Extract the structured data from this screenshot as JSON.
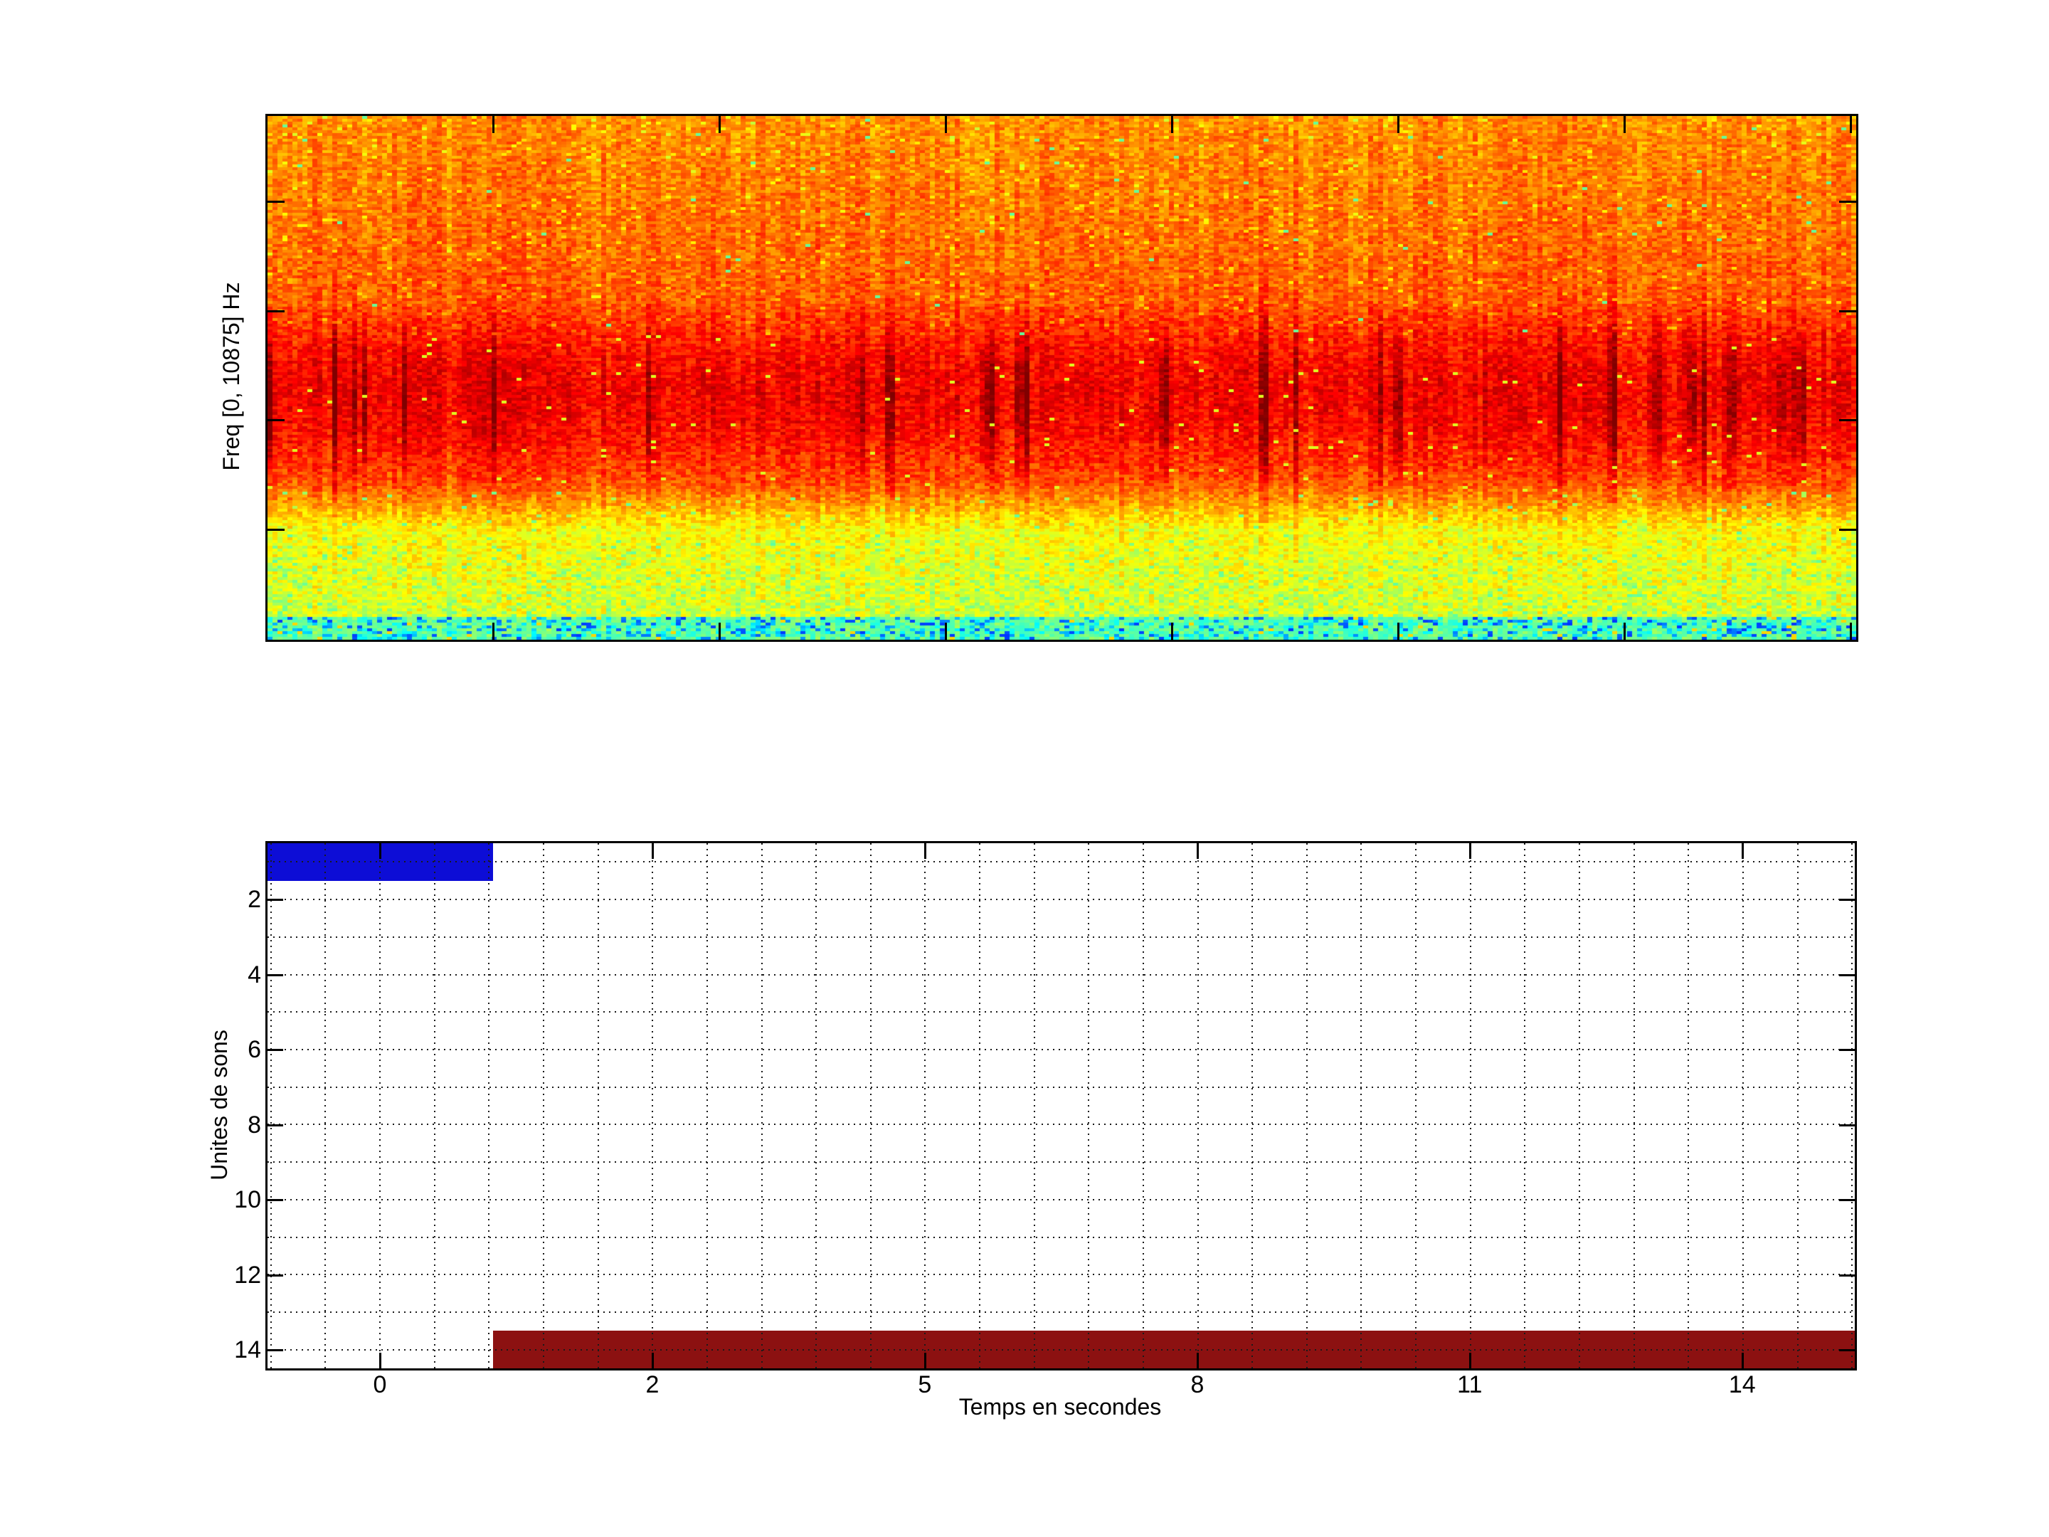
{
  "figure": {
    "background": "#ffffff",
    "border_color": "#000000",
    "grid_color": "#1a1a1a"
  },
  "spectrogram": {
    "ylabel": "Freq [0, 10875] Hz",
    "colormap": "jet",
    "noise_seed": 7,
    "x_tick_fracs": [
      0.142,
      0.2844,
      0.4267,
      0.5692,
      0.7116,
      0.854,
      0.9965
    ],
    "y_tick_fracs": [
      0.163,
      0.3723,
      0.5802,
      0.7894
    ],
    "bands": [
      {
        "name": "high-freq orange noise field",
        "from_frac": 0.0,
        "to_frac": 0.36,
        "dominant_colors": [
          "#ff8400",
          "#ffc800",
          "#ff3c00"
        ]
      },
      {
        "name": "mid-band intense red striations",
        "from_frac": 0.36,
        "to_frac": 0.7,
        "dominant_colors": [
          "#ff2a00",
          "#c81e00",
          "#ff7800"
        ]
      },
      {
        "name": "red-to-orange fade",
        "from_frac": 0.7,
        "to_frac": 0.792,
        "dominant_colors": [
          "#ff6a00",
          "#ffb000"
        ]
      },
      {
        "name": "low-freq yellow band with green specks",
        "from_frac": 0.792,
        "to_frac": 0.959,
        "dominant_colors": [
          "#f4f000",
          "#8ce85a"
        ]
      },
      {
        "name": "lowest-freq cyan band with blue dashes",
        "from_frac": 0.959,
        "to_frac": 1.0,
        "dominant_colors": [
          "#46e6c8",
          "#2050ff"
        ]
      }
    ]
  },
  "bar_chart": {
    "xlabel": "Temps en secondes",
    "ylabel": "Unites de sons",
    "x_ticks": [
      {
        "label": "0",
        "frac": 0.0708
      },
      {
        "label": "2",
        "frac": 0.2425
      },
      {
        "label": "5",
        "frac": 0.4141
      },
      {
        "label": "8",
        "frac": 0.5858
      },
      {
        "label": "11",
        "frac": 0.7574
      },
      {
        "label": "14",
        "frac": 0.9291
      }
    ],
    "x_minor": {
      "start_frac": 0.00215,
      "step_frac": 0.03435,
      "count": 30
    },
    "y_ticks": [
      {
        "label": "2",
        "frac": 0.1077
      },
      {
        "label": "4",
        "frac": 0.2506
      },
      {
        "label": "6",
        "frac": 0.3934
      },
      {
        "label": "8",
        "frac": 0.5363
      },
      {
        "label": "10",
        "frac": 0.6791
      },
      {
        "label": "12",
        "frac": 0.8219
      },
      {
        "label": "14",
        "frac": 0.9648
      }
    ],
    "y_minor": {
      "unit_frac": 0.07143,
      "first_unit": 1,
      "count": 14
    },
    "bars": [
      {
        "name": "bar-unit-1",
        "unit": 1,
        "color": "#0d0dd6",
        "x_frac": [
          0.0,
          0.1421
        ],
        "y_frac": [
          0.0,
          0.0712
        ]
      },
      {
        "name": "bar-unit-14",
        "unit": 14,
        "color": "#8c1111",
        "x_frac": [
          0.1421,
          1.0
        ],
        "y_frac": [
          0.9282,
          1.0
        ]
      }
    ]
  },
  "chart_data": [
    {
      "type": "heatmap",
      "subplot": "top",
      "title": "",
      "xlabel": "",
      "ylabel": "Freq [0, 10875] Hz",
      "colormap": "jet",
      "x_axis": {
        "ticks_labeled": false,
        "n_ticks": 7,
        "tick_fracs": [
          0.142,
          0.2844,
          0.4267,
          0.5692,
          0.7116,
          0.854,
          0.9965
        ]
      },
      "y_axis": {
        "range_hz": [
          0,
          10875
        ],
        "ticks_labeled": false,
        "n_ticks": 4
      },
      "content": "Audio spectrogram of continuous noise: orange high-energy field across upper frequencies with yellow flecks, darker red vertical striations in the mid band, a yellow band with green/cyan specks at low frequencies, and a thin cyan band with blue dashes at the lowest frequencies"
    },
    {
      "type": "bar",
      "subplot": "bottom",
      "orientation": "horizontal",
      "xlabel": "Temps en secondes",
      "ylabel": "Unites de sons",
      "x_tick_labels": [
        "0",
        "2",
        "5",
        "8",
        "11",
        "14"
      ],
      "y_tick_labels": [
        "2",
        "4",
        "6",
        "8",
        "10",
        "12",
        "14"
      ],
      "y_range": [
        0.5,
        14.5
      ],
      "grid": "dotted minor grid on both axes",
      "bars": [
        {
          "unit": 1,
          "start_s": -0.85,
          "end_s": 0.85,
          "color": "#0d0dd6",
          "note": "clipped at left axis edge"
        },
        {
          "unit": 14,
          "start_s": 0.85,
          "end_s": 15.2,
          "color": "#8c1111",
          "note": "clipped at right axis edge"
        }
      ]
    }
  ]
}
